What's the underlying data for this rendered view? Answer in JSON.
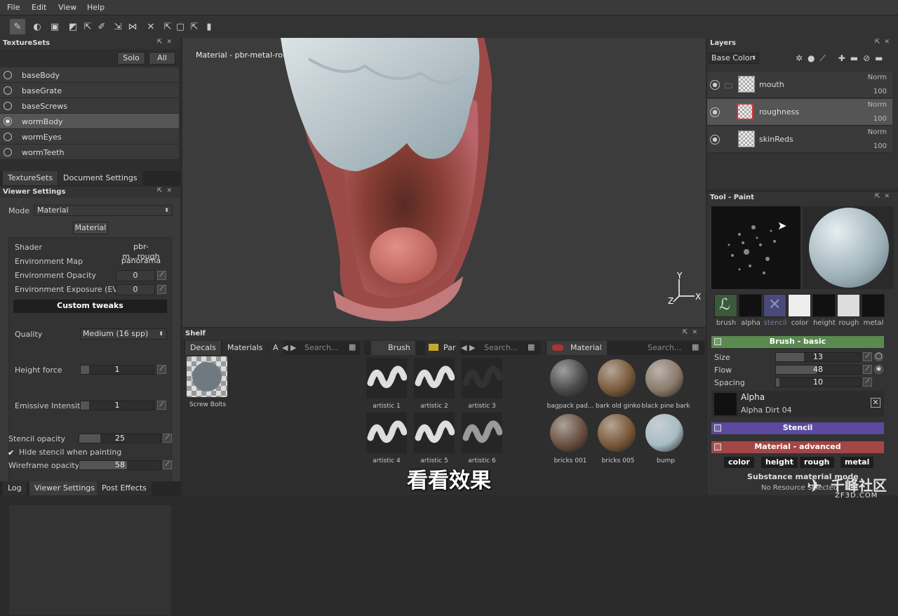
{
  "menu": [
    "File",
    "Edit",
    "View",
    "Help"
  ],
  "toolbar_icons": [
    "paint-brush-icon",
    "eraser-icon",
    "projection-icon",
    "polygon-fill-icon",
    "smudge-icon",
    "clone-icon",
    "color-picker-icon",
    "symmetry-icon",
    "symmetry-axis-icon",
    "2d-3d-icon",
    "3d-view-icon",
    "camera-icon"
  ],
  "texturesets": {
    "title": "TextureSets",
    "solo": "Solo",
    "all": "All",
    "items": [
      "baseBody",
      "baseGrate",
      "baseScrews",
      "wormBody",
      "wormEyes",
      "wormTeeth"
    ],
    "selected_index": 3
  },
  "left_tabs": [
    "TextureSets",
    "Document Settings"
  ],
  "viewer": {
    "title": "Viewer Settings",
    "mode_label": "Mode",
    "mode_value": "Material",
    "material_btn": "Material",
    "shader_label": "Shader",
    "shader_value": "pbr-m...rough",
    "envmap_label": "Environment Map",
    "envmap_value": "panorama",
    "envop_label": "Environment Opacity",
    "envop_value": "0",
    "envexp_label": "Environment Exposure (EV)",
    "envexp_value": "0",
    "custom_tweaks": "Custom tweaks",
    "quality_label": "Quality",
    "quality_value": "Medium (16 spp)",
    "height_label": "Height force",
    "height_value": "1",
    "emissive_label": "Emissive Intensity",
    "emissive_value": "1",
    "stencil_label": "Stencil opacity",
    "stencil_value": "25",
    "hide_stencil_label": "Hide stencil when painting",
    "wire_label": "Wireframe opacity",
    "wire_value": "58"
  },
  "bottom_tabs": [
    "Log",
    "Viewer Settings",
    "Post Effects"
  ],
  "viewport": {
    "label": "Material - pbr-metal-rough",
    "axis_x": "X",
    "axis_y": "Y",
    "axis_z": "Z"
  },
  "shelf": {
    "title": "Shelf",
    "left_tabs": [
      "Decals",
      "Materials",
      "A"
    ],
    "search_placeholder": "Search...",
    "decal_items": [
      "Screw Bolts"
    ],
    "brush_tab": "Brush",
    "par_tab": "Par",
    "brush_items": [
      "artistic 1",
      "artistic 2",
      "artistic 3",
      "artistic 4",
      "artistic 5",
      "artistic 6"
    ],
    "material_tab": "Material",
    "material_items": [
      "bagpack pad...",
      "bark old ginko",
      "black pine bark",
      "bricks 001",
      "bricks 005",
      "bump"
    ]
  },
  "layers": {
    "title": "Layers",
    "channel": "Base Color",
    "items": [
      {
        "name": "mouth",
        "blend": "Norm",
        "opacity": "100"
      },
      {
        "name": "roughness",
        "blend": "Norm",
        "opacity": "100"
      },
      {
        "name": "skinReds",
        "blend": "Norm",
        "opacity": "100"
      }
    ]
  },
  "tool": {
    "title": "Tool - Paint",
    "swatches": [
      "brush",
      "alpha",
      "stencil",
      "color",
      "height",
      "rough",
      "metal"
    ],
    "brush_basic": "Brush - basic",
    "size_label": "Size",
    "size_value": "13",
    "flow_label": "Flow",
    "flow_value": "48",
    "spacing_label": "Spacing",
    "spacing_value": "10",
    "alpha_title": "Alpha",
    "alpha_name": "Alpha Dirt 04",
    "stencil_section": "Stencil",
    "material_section": "Material - advanced",
    "channels": [
      "color",
      "height",
      "rough",
      "metal"
    ],
    "substance_label": "Substance material mode",
    "no_resource": "No Resource Selected"
  },
  "subtitle": "看看效果",
  "watermark": {
    "main": "千峰社区",
    "sub": "ZF3D.COM"
  },
  "colors": {
    "brush_basic": "#5a8a50",
    "stencil": "#5b4a9e",
    "material_advanced": "#a34646",
    "selected_row": "#555555"
  }
}
